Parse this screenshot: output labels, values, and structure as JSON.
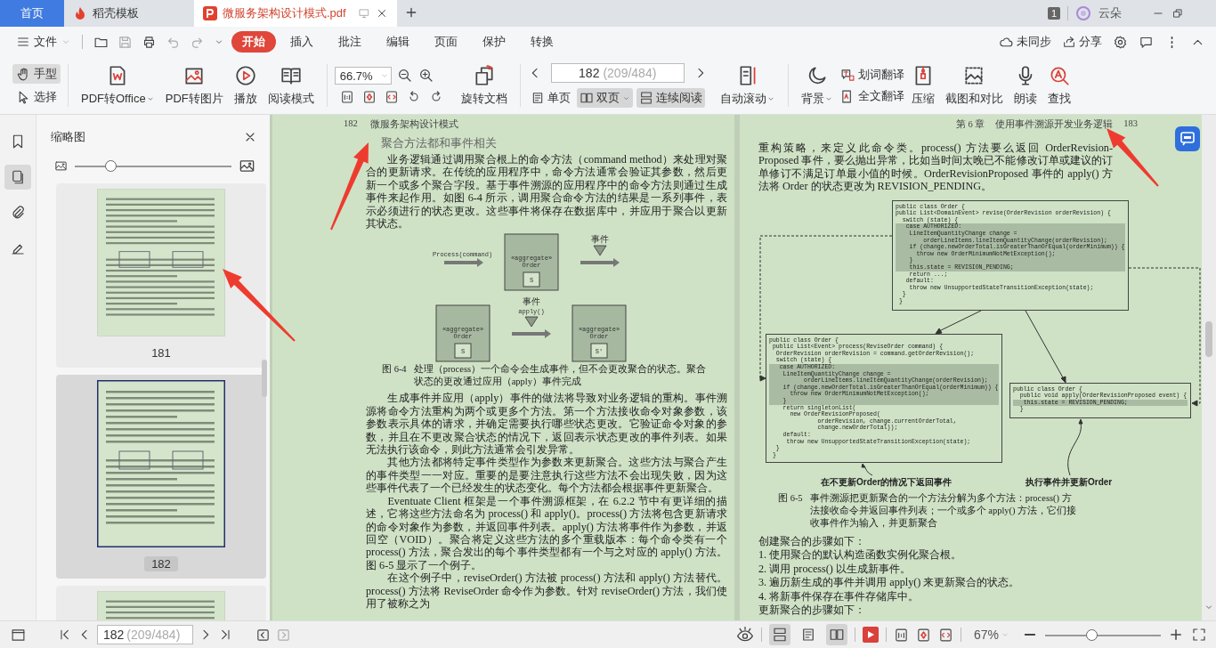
{
  "tabs": [
    {
      "label": "首页",
      "kind": "home",
      "selected": false
    },
    {
      "label": "稻壳模板",
      "kind": "store",
      "selected": false
    },
    {
      "label": "微服务架构设计模式.pdf",
      "kind": "pdf",
      "selected": true
    }
  ],
  "title_bar": {
    "badge": "1",
    "user": "云朵"
  },
  "menu": {
    "file": "文件",
    "tabs": [
      {
        "label": "开始",
        "selected": true
      },
      {
        "label": "插入",
        "selected": false
      },
      {
        "label": "批注",
        "selected": false
      },
      {
        "label": "编辑",
        "selected": false
      },
      {
        "label": "页面",
        "selected": false
      },
      {
        "label": "保护",
        "selected": false
      },
      {
        "label": "转换",
        "selected": false
      }
    ],
    "sync": "未同步",
    "share": "分享"
  },
  "toolbar": {
    "modes": [
      {
        "label": "手型",
        "kind": "hand",
        "selected": true
      },
      {
        "label": "选择",
        "kind": "cursor",
        "selected": false
      }
    ],
    "convert": [
      {
        "label": "PDF转Office",
        "kind": "pdf-office",
        "dropdown": true
      },
      {
        "label": "PDF转图片",
        "kind": "pdf-image",
        "dropdown": false
      },
      {
        "label": "播放",
        "kind": "play",
        "dropdown": false
      },
      {
        "label": "阅读模式",
        "kind": "read",
        "dropdown": false
      }
    ],
    "zoom": "66.7%",
    "rotate": "旋转文档",
    "page": {
      "current": "182",
      "total": "(209/484)"
    },
    "views": [
      {
        "label": "单页",
        "kind": "single",
        "selected": false,
        "dropdown": false
      },
      {
        "label": "双页",
        "kind": "double",
        "selected": true,
        "dropdown": true
      },
      {
        "label": "连续阅读",
        "kind": "continuous",
        "selected": true,
        "dropdown": false
      }
    ],
    "tools": [
      {
        "label": "自动滚动",
        "kind": "autoscroll",
        "dropdown": true
      },
      {
        "label": "背景",
        "kind": "background",
        "dropdown": true
      }
    ],
    "translate": [
      {
        "label": "划词翻译",
        "kind": "word-translate"
      },
      {
        "label": "全文翻译",
        "kind": "full-translate"
      }
    ],
    "more": [
      {
        "label": "压缩",
        "kind": "compress"
      },
      {
        "label": "截图和对比",
        "kind": "screenshot"
      },
      {
        "label": "朗读",
        "kind": "read-aloud"
      },
      {
        "label": "查找",
        "kind": "find"
      }
    ]
  },
  "sidebar": {
    "rail": [
      {
        "kind": "bookmark",
        "selected": false
      },
      {
        "kind": "thumbs",
        "selected": true
      },
      {
        "kind": "clip",
        "selected": false
      },
      {
        "kind": "sign",
        "selected": false
      }
    ],
    "title": "缩略图",
    "thumb_size": {
      "level": 0.23
    },
    "thumbnails": [
      {
        "label": "181",
        "selected": false
      },
      {
        "label": "182",
        "selected": true
      },
      {
        "selected": false
      }
    ]
  },
  "left_page": {
    "number": "182",
    "running_title": "微服务架构设计模式",
    "heading": "聚合方法都和事件相关",
    "paragraphs_before": [
      "业务逻辑通过调用聚合根上的命令方法（command method）来处理对聚合的更新请求。在传统的应用程序中，命令方法通常会验证其参数，然后更新一个或多个聚合字段。基于事件溯源的应用程序中的命令方法则通过生成事件来起作用。如图 6-4 所示，调用聚合命令方法的结果是一系列事件，表示必须进行的状态更改。这些事件将保存在数据库中，并应用于聚合以更新其状态。"
    ],
    "figure": {
      "command_label": "Process(command)",
      "event_label": "事件",
      "apply_labels": [
        "事件",
        "apply()"
      ],
      "boxes": [
        {
          "stereotype": "«aggregate»",
          "name": "Order",
          "state": "S"
        },
        {
          "stereotype": "«aggregate»",
          "name": "Order",
          "state": "S"
        },
        {
          "stereotype": "«aggregate»",
          "name": "Order",
          "state": "S'"
        }
      ],
      "caption_label": "图 6-4",
      "caption": "处理（process）一个命令会生成事件，但不会更改聚合的状态。聚合状态的更改通过应用（apply）事件完成"
    },
    "paragraphs_after": [
      "生成事件并应用（apply）事件的做法将导致对业务逻辑的重构。事件溯源将命令方法重构为两个或更多个方法。第一个方法接收命令对象参数，该参数表示具体的请求，并确定需要执行哪些状态更改。它验证命令对象的参数，并且在不更改聚合状态的情况下，返回表示状态更改的事件列表。如果无法执行该命令，则此方法通常会引发异常。",
      "其他方法都将特定事件类型作为参数来更新聚合。这些方法与聚合产生的事件类型一一对应。重要的是要注意执行这些方法不会出现失败，因为这些事件代表了一个已经发生的状态变化。每个方法都会根据事件更新聚合。",
      "Eventuate Client 框架是一个事件溯源框架，在 6.2.2 节中有更详细的描述，它将这些方法命名为 process() 和 apply()。process() 方法将包含更新请求的命令对象作为参数，并返回事件列表。apply() 方法将事件作为参数，并返回空（VOID）。聚合将定义这些方法的多个重载版本：每个命令类有一个 process() 方法，聚合发出的每个事件类型都有一个与之对应的 apply() 方法。图 6-5 显示了一个例子。",
      "在这个例子中，reviseOrder() 方法被 process() 方法和 apply() 方法替代。process() 方法将 ReviseOrder 命令作为参数。针对 reviseOrder() 方法，我们使用了被称之为"
    ]
  },
  "right_page": {
    "chapter": "第 6 章",
    "running_title": "使用事件溯源开发业务逻辑",
    "number": "183",
    "paragraph": "重构策略，来定义此命令类。process() 方法要么返回 OrderRevision-Proposed 事件，要么抛出异常，比如当时间太晚已不能修改订单或建议的订单修订不满足订单最小值的时候。OrderRevisionProposed 事件的 apply() 方法将 Order 的状态更改为 REVISION_PENDING。",
    "figure": {
      "code_boxes": [
        {
          "lines": [
            {
              "text": "public class Order {",
              "highlighted": false
            },
            {
              "text": "public List<DomainEvent> revise(OrderRevision orderRevision) {",
              "highlighted": false
            },
            {
              "text": "  switch (state) {",
              "highlighted": false
            },
            {
              "text": "   case AUTHORIZED:",
              "highlighted": true
            },
            {
              "text": "    LineItemQuantityChange change =",
              "highlighted": true
            },
            {
              "text": "        orderLineItems.lineItemQuantityChange(orderRevision);",
              "highlighted": true
            },
            {
              "text": "    if (change.newOrderTotal.isGreaterThanOrEqual(orderMinimum)) {",
              "highlighted": true
            },
            {
              "text": "      throw new OrderMinimumNotMetException();",
              "highlighted": true
            },
            {
              "text": "    }",
              "highlighted": true
            },
            {
              "text": "    this.state = REVISION_PENDING;",
              "highlighted": true
            },
            {
              "text": "    return ...;",
              "highlighted": false
            },
            {
              "text": "   default:",
              "highlighted": false
            },
            {
              "text": "    throw new UnsupportedStateTransitionException(state);",
              "highlighted": false
            },
            {
              "text": "  }",
              "highlighted": false
            },
            {
              "text": " }",
              "highlighted": false
            }
          ]
        },
        {
          "lines": [
            {
              "text": "public class Order {",
              "highlighted": false
            },
            {
              "text": " public List<Event> process(ReviseOrder command) {",
              "highlighted": false
            },
            {
              "text": "  OrderRevision orderRevision = command.getOrderRevision();",
              "highlighted": false
            },
            {
              "text": "  switch (state) {",
              "highlighted": false
            },
            {
              "text": "   case AUTHORIZED:",
              "highlighted": true
            },
            {
              "text": "    LineItemQuantityChange change =",
              "highlighted": true
            },
            {
              "text": "          orderLineItems.lineItemQuantityChange(orderRevision);",
              "highlighted": true
            },
            {
              "text": "    if (change.newOrderTotal.isGreaterThanOrEqual(orderMinimum)) {",
              "highlighted": true
            },
            {
              "text": "      throw new OrderMinimumNotMetException();",
              "highlighted": true
            },
            {
              "text": "    }",
              "highlighted": true
            },
            {
              "text": "    return singletonList(",
              "highlighted": false
            },
            {
              "text": "      new OrderRevisionProposed(",
              "highlighted": false
            },
            {
              "text": "              orderRevision, change.currentOrderTotal,",
              "highlighted": false
            },
            {
              "text": "              change.newOrderTotal));",
              "highlighted": false
            },
            {
              "text": "    default:",
              "highlighted": false
            },
            {
              "text": "     throw new UnsupportedStateTransitionException(state);",
              "highlighted": false
            },
            {
              "text": "  }",
              "highlighted": false
            },
            {
              "text": " }",
              "highlighted": false
            }
          ]
        },
        {
          "lines": [
            {
              "text": "public class Order {",
              "highlighted": false
            },
            {
              "text": "  public void apply(OrderRevisionProposed event) {",
              "highlighted": false
            },
            {
              "text": "   this.state = REVISION_PENDING;",
              "highlighted": true
            },
            {
              "text": "  }",
              "highlighted": false
            }
          ]
        }
      ],
      "notes": [
        "在不更新Order的情况下返回事件",
        "执行事件并更新Order"
      ],
      "caption_label": "图 6-5",
      "caption": "事件溯源把更新聚合的一个方法分解为多个方法：process() 方法接收命令并返回事件列表；一个或多个 apply() 方法，它们接收事件作为输入，并更新聚合"
    },
    "steps_title": "创建聚合的步骤如下：",
    "steps": [
      "1. 使用聚合的默认构造函数实例化聚合根。",
      "2. 调用 process() 以生成新事件。",
      "3. 遍历新生成的事件并调用 apply() 来更新聚合的状态。",
      "4. 将新事件保存在事件存储库中。"
    ],
    "next_title": "更新聚合的步骤如下："
  },
  "status_bar": {
    "page": {
      "current": "182",
      "total": "(209/484)"
    },
    "views": [
      {
        "kind": "continuous",
        "selected": true
      },
      {
        "kind": "single",
        "selected": false
      },
      {
        "kind": "double",
        "selected": true
      }
    ],
    "zoom": "67%",
    "zoom_slider": {
      "level": 0.4
    }
  }
}
